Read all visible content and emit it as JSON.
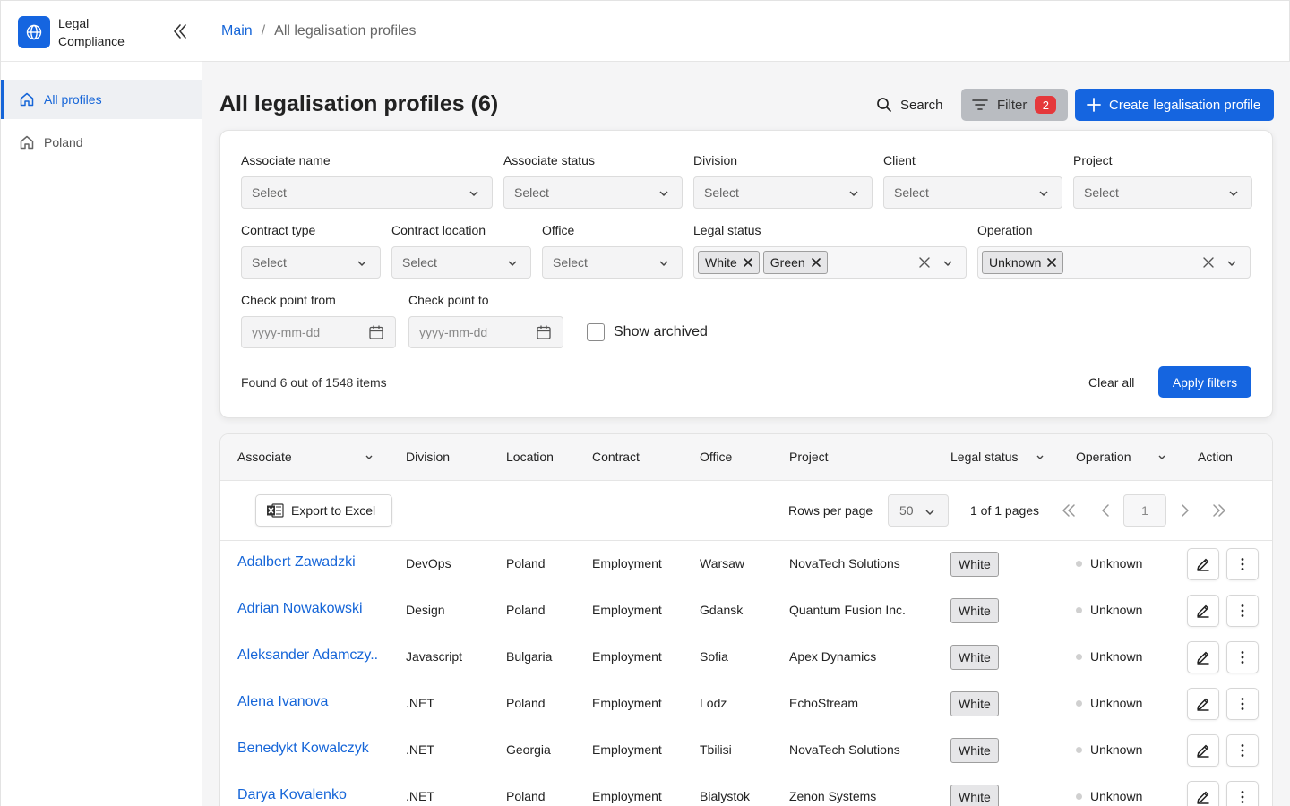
{
  "app": {
    "title": "Legal Compliance"
  },
  "sidebar": {
    "items": [
      {
        "label": "All profiles",
        "icon": "home-icon",
        "active": true
      },
      {
        "label": "Poland",
        "icon": "home-icon",
        "active": false
      }
    ]
  },
  "breadcrumb": {
    "root": "Main",
    "separator": "/",
    "current": "All legalisation profiles"
  },
  "page": {
    "title": "All legalisation profiles (6)"
  },
  "actions": {
    "search": "Search",
    "filter": "Filter",
    "filter_count": "2",
    "create": "Create legalisation profile"
  },
  "filters": {
    "associate_name": {
      "label": "Associate name",
      "value": "Select"
    },
    "associate_status": {
      "label": "Associate status",
      "value": "Select"
    },
    "division": {
      "label": "Division",
      "value": "Select"
    },
    "client": {
      "label": "Client",
      "value": "Select"
    },
    "project": {
      "label": "Project",
      "value": "Select"
    },
    "contract_type": {
      "label": "Contract type",
      "value": "Select"
    },
    "contract_location": {
      "label": "Contract location",
      "value": "Select"
    },
    "office": {
      "label": "Office",
      "value": "Select"
    },
    "legal_status": {
      "label": "Legal status",
      "tags": [
        "White",
        "Green"
      ]
    },
    "operation": {
      "label": "Operation",
      "tags": [
        "Unknown"
      ]
    },
    "check_from": {
      "label": "Check point from",
      "placeholder": "yyyy-mm-dd"
    },
    "check_to": {
      "label": "Check point to",
      "placeholder": "yyyy-mm-dd"
    },
    "show_archived": {
      "label": "Show archived",
      "checked": false
    },
    "found": "Found 6 out of 1548 items",
    "clear_all": "Clear all",
    "apply": "Apply filters"
  },
  "table": {
    "columns": [
      "Associate",
      "Division",
      "Location",
      "Contract",
      "Office",
      "Project",
      "Legal status",
      "Operation",
      "Action"
    ],
    "export": "Export to Excel",
    "rows_per_page_label": "Rows per page",
    "rows_per_page": "50",
    "pages": "1 of 1 pages",
    "page_number": "1",
    "rows": [
      {
        "name": "Adalbert Zawadzki",
        "division": "DevOps",
        "location": "Poland",
        "contract": "Employment",
        "office": "Warsaw",
        "project": "NovaTech Solutions",
        "legal_status": "White",
        "operation": "Unknown"
      },
      {
        "name": "Adrian Nowakowski",
        "division": "Design",
        "location": "Poland",
        "contract": "Employment",
        "office": "Gdansk",
        "project": "Quantum Fusion Inc.",
        "legal_status": "White",
        "operation": "Unknown"
      },
      {
        "name": "Aleksander Adamczy..",
        "division": "Javascript",
        "location": "Bulgaria",
        "contract": "Employment",
        "office": "Sofia",
        "project": "Apex Dynamics",
        "legal_status": "White",
        "operation": "Unknown"
      },
      {
        "name": "Alena Ivanova",
        "division": ".NET",
        "location": "Poland",
        "contract": "Employment",
        "office": "Lodz",
        "project": "EchoStream",
        "legal_status": "White",
        "operation": "Unknown"
      },
      {
        "name": "Benedykt Kowalczyk",
        "division": ".NET",
        "location": "Georgia",
        "contract": "Employment",
        "office": "Tbilisi",
        "project": "NovaTech Solutions",
        "legal_status": "White",
        "operation": "Unknown"
      },
      {
        "name": "Darya Kovalenko",
        "division": ".NET",
        "location": "Poland",
        "contract": "Employment",
        "office": "Bialystok",
        "project": "Zenon Systems",
        "legal_status": "White",
        "operation": "Unknown"
      }
    ]
  },
  "colors": {
    "accent": "#1565e0",
    "link": "#1565d8",
    "badge": "#e5383b",
    "filter_active": "#b9bcc1"
  }
}
